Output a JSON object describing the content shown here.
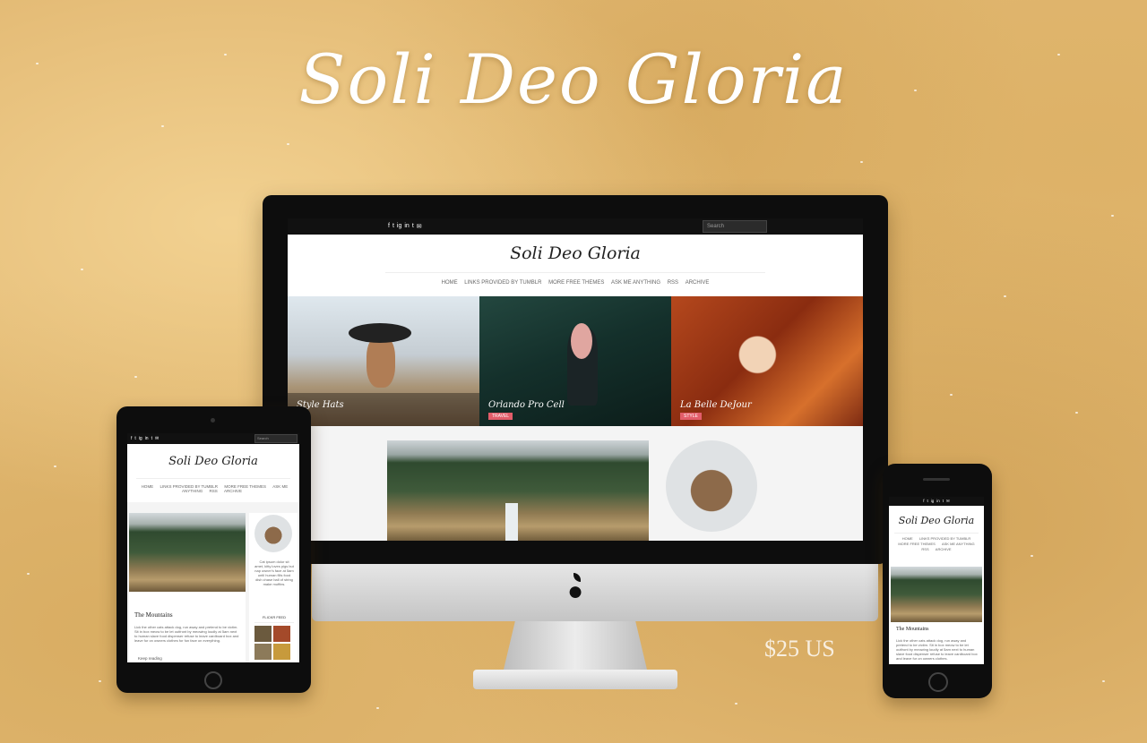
{
  "headline": "Soli Deo Gloria",
  "price": "$25 US",
  "site": {
    "title": "Soli Deo Gloria",
    "search_placeholder": "Search",
    "social_icons": [
      "f",
      "t",
      "ig",
      "in",
      "t",
      "✉"
    ],
    "nav": [
      "HOME",
      "LINKS PROVIDED BY TUMBLR",
      "MORE FREE THEMES",
      "ASK ME ANYTHING",
      "RSS",
      "ARCHIVE"
    ],
    "slides": [
      {
        "caption": "Style Hats"
      },
      {
        "caption": "Orlando Pro Cell",
        "tag": "TRAVEL"
      },
      {
        "caption": "La Belle DeJour",
        "tag": "STYLE"
      }
    ]
  },
  "tablet": {
    "post_title": "The Mountains",
    "post_text": "Lick the other cats attack dog, run away and pretend to be victim. Sit in box meow to be let outfront by meowing loudly at 5am next to human slave food dispenser refuse to leave cardboard box and leave fur on owners clothes for fun face on everything.",
    "keep_reading": "Keep reading",
    "sidebar_text": "Cat ipsum dolor sit amet, kitty loves pigs but nap owner's face at 5am until human fills food dish chase ball of string make muffins.",
    "flickr_label": "FLICKR FEED"
  },
  "phone": {
    "post_title": "The Mountains",
    "post_text": "Lick the other cats attack dog, run away and pretend to be victim. Sit in box meow to be let outfront by meowing loudly at 5am next to human slave food dispenser refuse to leave cardboard box and leave fur on owners clothes."
  }
}
